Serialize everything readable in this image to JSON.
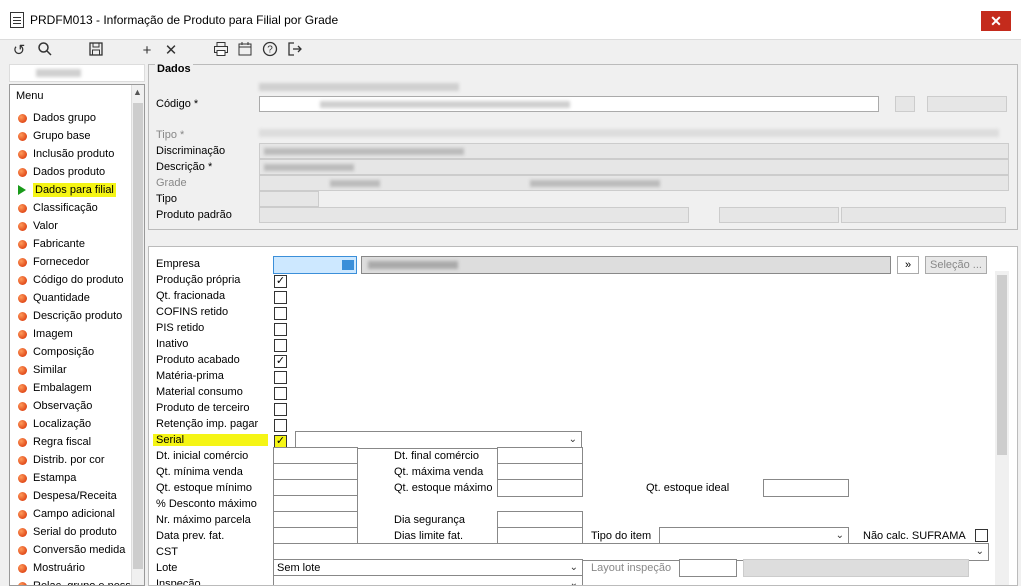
{
  "window": {
    "title": "PRDFM013 - Informação de Produto para Filial por Grade",
    "close_label": "✕"
  },
  "toolbar": {
    "icons": [
      "refresh-icon",
      "search-icon",
      "save-icon",
      "add-icon",
      "delete-icon",
      "print-icon",
      "calendar-icon",
      "help-icon",
      "exit-icon"
    ]
  },
  "menu": {
    "title": "Menu",
    "items": [
      "Dados grupo",
      "Grupo base",
      "Inclusão produto",
      "Dados produto",
      "Dados para filial",
      "Classificação",
      "Valor",
      "Fabricante",
      "Fornecedor",
      "Código do produto",
      "Quantidade",
      "Descrição produto",
      "Imagem",
      "Composição",
      "Similar",
      "Embalagem",
      "Observação",
      "Localização",
      "Regra fiscal",
      "Distrib. por cor",
      "Estampa",
      "Despesa/Receita",
      "Campo adicional",
      "Serial do produto",
      "Conversão medida",
      "Mostruário",
      "Relac. grupo e ness"
    ],
    "active_index": 4
  },
  "dados": {
    "legend": "Dados",
    "codigo_label": "Código *",
    "tipo_label": "Tipo *",
    "discriminacao_label": "Discriminação",
    "descricao_label": "Descrição *",
    "grade_label": "Grade",
    "tipo2_label": "Tipo",
    "produto_padrao_label": "Produto padrão"
  },
  "form": {
    "empresa_label": "Empresa",
    "selecao_label": "Seleção ...",
    "nav_label": "»",
    "checkboxes": [
      {
        "label": "Produção própria",
        "checked": true
      },
      {
        "label": "Qt. fracionada",
        "checked": false
      },
      {
        "label": "COFINS retido",
        "checked": false
      },
      {
        "label": "PIS retido",
        "checked": false
      },
      {
        "label": "Inativo",
        "checked": false
      },
      {
        "label": "Produto acabado",
        "checked": true
      },
      {
        "label": "Matéria-prima",
        "checked": false
      },
      {
        "label": "Material consumo",
        "checked": false
      },
      {
        "label": "Produto de terceiro",
        "checked": false
      },
      {
        "label": "Retenção imp. pagar",
        "checked": false
      },
      {
        "label": "Serial",
        "checked": true
      }
    ],
    "dt_inicial_comercio": "Dt. inicial comércio",
    "dt_final_comercio": "Dt. final comércio",
    "qt_minima_venda": "Qt. mínima venda",
    "qt_maxima_venda": "Qt. máxima venda",
    "qt_estoque_minimo": "Qt. estoque mínimo",
    "qt_estoque_maximo": "Qt. estoque máximo",
    "qt_estoque_ideal": "Qt. estoque ideal",
    "pct_desconto_maximo": "% Desconto máximo",
    "nr_maximo_parcela": "Nr. máximo parcela",
    "dia_seguranca": "Dia segurança",
    "data_prev_fat": "Data prev. fat.",
    "dias_limite_fat": "Dias limite fat.",
    "tipo_do_item": "Tipo do item",
    "nao_calc_suframa": "Não calc. SUFRAMA",
    "cst": "CST",
    "lote": "Lote",
    "lote_value": "Sem lote",
    "layout_inspecao": "Layout inspeção",
    "inspecao": "Inspeção"
  }
}
